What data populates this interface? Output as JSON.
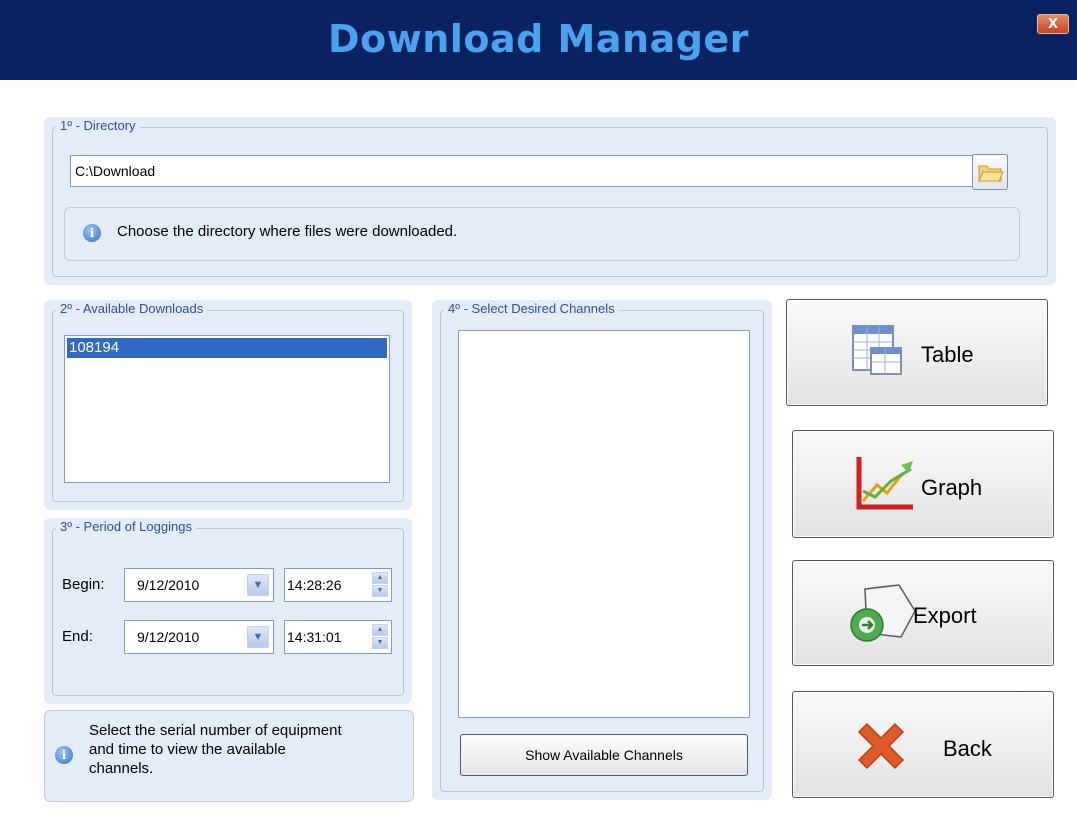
{
  "window": {
    "title": "Download Manager",
    "close_label": "X"
  },
  "directory": {
    "legend": "1º - Directory",
    "path_value": "C:\\Download",
    "browse_icon": "folder-icon",
    "info_text": "Choose the directory where files were downloaded."
  },
  "downloads": {
    "legend": "2º - Available Downloads",
    "items": [
      "108194"
    ],
    "selected_index": 0
  },
  "period": {
    "legend": "3º - Period of Loggings",
    "begin_label": "Begin:",
    "begin_date": "9/12/2010",
    "begin_time": "14:28:26",
    "end_label": "End:",
    "end_date": "9/12/2010",
    "end_time": "14:31:01"
  },
  "hint": {
    "text_line1": "Select the serial number of equipment",
    "text_line2": "and time to view the available",
    "text_line3": "channels."
  },
  "channels": {
    "legend": "4º - Select Desired Channels",
    "items": [],
    "show_button_label": "Show Available Channels"
  },
  "actions": {
    "table_label": "Table",
    "graph_label": "Graph",
    "export_label": "Export",
    "back_label": "Back"
  },
  "colors": {
    "titlebar": "#0a2260",
    "title_text": "#4aa3f0",
    "panel": "#e4ecf7",
    "legend_text": "#2a50a0",
    "selection": "#316ac5"
  }
}
